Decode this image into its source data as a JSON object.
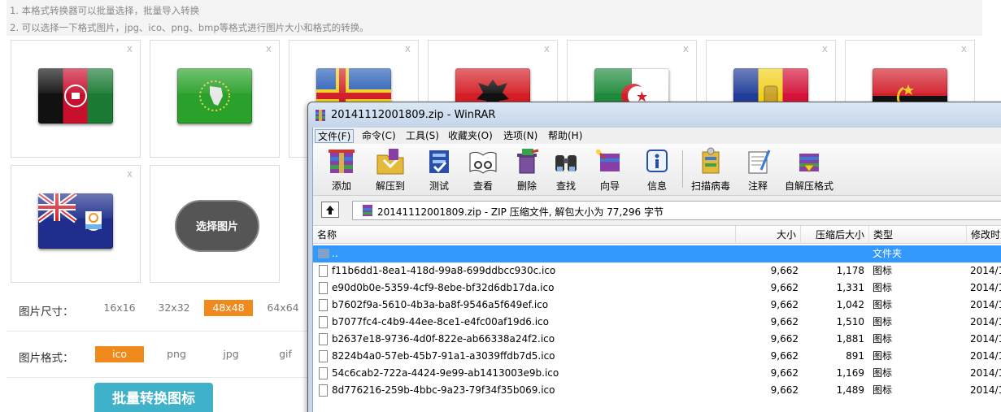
{
  "tips": {
    "line1": "1. 本格式转换器可以批量选择，批量导入转换",
    "line2": "2. 可以选择一下格式图片，jpg、ico、png、bmp等格式进行图片大小和格式的转换。"
  },
  "tiles": {
    "close_glyph": "x",
    "flags": [
      "afghanistan",
      "african-union",
      "aland-islands",
      "albania",
      "algeria",
      "andorra",
      "angola",
      "anguilla"
    ],
    "select_button": "选择图片"
  },
  "options": {
    "size_label": "图片尺寸：",
    "sizes": [
      "16x16",
      "32x32",
      "48x48",
      "64x64"
    ],
    "selected_size": "48x48",
    "format_label": "图片格式：",
    "formats": [
      "ico",
      "png",
      "jpg",
      "gif"
    ],
    "selected_format": "ico",
    "convert_button": "批量转换图标",
    "accent_color": "#f08a1c",
    "button_color": "#3fb2c9"
  },
  "winrar": {
    "title": "20141112001809.zip - WinRAR",
    "menu": [
      "文件(F)",
      "命令(C)",
      "工具(S)",
      "收藏夹(O)",
      "选项(N)",
      "帮助(H)"
    ],
    "toolbar": [
      "添加",
      "解压到",
      "测试",
      "查看",
      "删除",
      "查找",
      "向导",
      "信息",
      "扫描病毒",
      "注释",
      "自解压格式"
    ],
    "path": "20141112001809.zip - ZIP 压缩文件, 解包大小为 77,296 字节",
    "columns": [
      "名称",
      "大小",
      "压缩后大小",
      "类型",
      "修改时"
    ],
    "parent_row": {
      "name": "..",
      "type": "文件夹"
    },
    "files": [
      {
        "name": "f11b6dd1-8ea1-418d-99a8-699ddbcc930c.ico",
        "size": "9,662",
        "packed": "1,178",
        "type": "图标",
        "date": "2014/1"
      },
      {
        "name": "e90d0b0e-5359-4cf9-8ebe-bf32d6db17da.ico",
        "size": "9,662",
        "packed": "1,331",
        "type": "图标",
        "date": "2014/1"
      },
      {
        "name": "b7602f9a-5610-4b3a-ba8f-9546a5f649ef.ico",
        "size": "9,662",
        "packed": "1,042",
        "type": "图标",
        "date": "2014/1"
      },
      {
        "name": "b7077fc4-c4b9-44ee-8ce1-e4fc00af19d6.ico",
        "size": "9,662",
        "packed": "1,510",
        "type": "图标",
        "date": "2014/1"
      },
      {
        "name": "b2637e18-9736-4d0f-822e-ab66338a24f2.ico",
        "size": "9,662",
        "packed": "1,881",
        "type": "图标",
        "date": "2014/1"
      },
      {
        "name": "8224b4a0-57eb-45b7-91a1-a3039ffdb7d5.ico",
        "size": "9,662",
        "packed": "891",
        "type": "图标",
        "date": "2014/1"
      },
      {
        "name": "54c6cab2-722a-4424-9e99-ab1413003e9b.ico",
        "size": "9,662",
        "packed": "1,169",
        "type": "图标",
        "date": "2014/1"
      },
      {
        "name": "8d776216-259b-4bbc-9a23-79f34f35b069.ico",
        "size": "9,662",
        "packed": "1,489",
        "type": "图标",
        "date": "2014/1"
      }
    ]
  }
}
